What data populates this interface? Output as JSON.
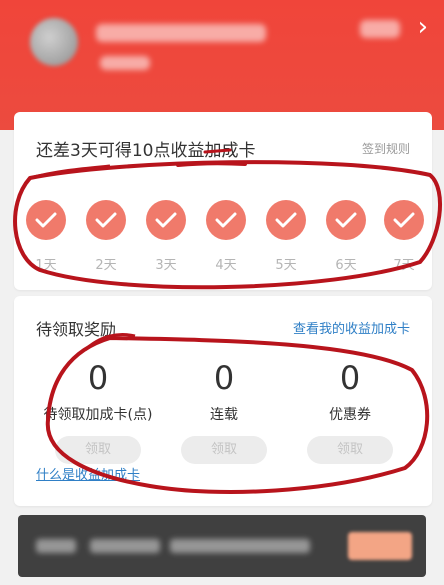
{
  "header": {
    "chevron_icon": "chevron-right-icon"
  },
  "signin": {
    "title": "还差3天可得10点收益加成卡",
    "rules_link": "签到规则",
    "days": [
      {
        "label": "1天",
        "checked": true
      },
      {
        "label": "2天",
        "checked": true
      },
      {
        "label": "3天",
        "checked": true
      },
      {
        "label": "4天",
        "checked": true
      },
      {
        "label": "5天",
        "checked": true
      },
      {
        "label": "6天",
        "checked": true
      },
      {
        "label": "7天",
        "checked": true
      }
    ]
  },
  "rewards": {
    "title": "待领取奖励",
    "view_link": "查看我的收益加成卡",
    "items": [
      {
        "value": "0",
        "label": "待领取加成卡(点)",
        "button": "领取"
      },
      {
        "value": "0",
        "label": "连载",
        "button": "领取"
      },
      {
        "value": "0",
        "label": "优惠券",
        "button": "领取"
      }
    ],
    "help_link": "什么是收益加成卡"
  },
  "colors": {
    "header_red": "#f0453a",
    "check_circle": "#f07a6b",
    "link_blue": "#2f7fc6",
    "annotation_red": "#b8141c"
  }
}
